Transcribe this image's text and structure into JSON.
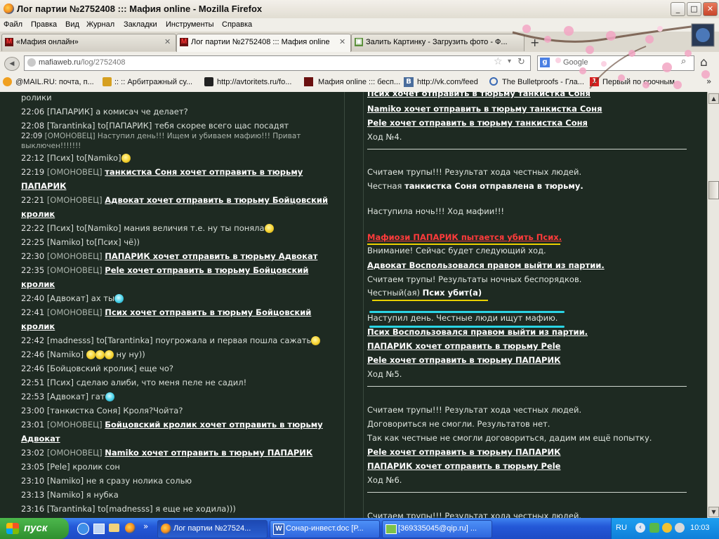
{
  "window": {
    "title": "Лог партии №2752408 ::: Мафия online - Mozilla Firefox",
    "min": "_",
    "max": "□",
    "close": "✕"
  },
  "menu": [
    "Файл",
    "Правка",
    "Вид",
    "Журнал",
    "Закладки",
    "Инструменты",
    "Справка"
  ],
  "tabs": [
    {
      "label": "«Мафия онлайн»",
      "close": "✕"
    },
    {
      "label": "Лог партии №2752408 ::: Мафия online",
      "close": "✕"
    },
    {
      "label": "Залить Картинку - Загрузить фото - Ф...",
      "close": "✕"
    }
  ],
  "tab_new": "+",
  "nav": {
    "back": "◀",
    "forward": "▶",
    "url_domain": "mafiaweb.ru",
    "url_path": "/log/2752408",
    "search_engine": "Google",
    "home": "⌂"
  },
  "bookmarks": [
    "@MAIL.RU: почта, п...",
    ":: :: Арбитражный су...",
    "http://avtoritets.ru/fo...",
    "Мафия online ::: бесп...",
    "http://vk.com/feed",
    "The Bulletproofs - Гла...",
    "Первый по срочным"
  ],
  "left_log": [
    {
      "time": "",
      "who": "",
      "msg": "ролики"
    },
    {
      "time": "22:06",
      "who": "[ПАПАРИК]",
      "msg": "а комисач че делает?"
    },
    {
      "time": "22:08",
      "who": "[Tarantinka]",
      "msg": "to[ПАПАРИК] тебя скорее всего щас посадят"
    },
    {
      "time": "22:09",
      "who": "[ОМОНОВЕЦ]",
      "msg": "Наступил день!!! Ищем и убиваем мафию!!! Приват"
    },
    {
      "time": "",
      "who": "",
      "msg": "выключен!!!!!!!"
    },
    {
      "time": "22:12",
      "who": "[Псих]",
      "msg": "to[Namiko]"
    },
    {
      "time": "22:19",
      "who": "[ОМОНОВЕЦ]",
      "msg": "танкистка Соня хочет отправить в тюрьму"
    },
    {
      "time": "",
      "who": "",
      "msg": "ПАПАРИК"
    },
    {
      "time": "22:21",
      "who": "[ОМОНОВЕЦ]",
      "msg": "Адвокат хочет отправить в тюрьму Бойцовский"
    },
    {
      "time": "",
      "who": "",
      "msg": "кролик"
    },
    {
      "time": "22:22",
      "who": "[Псих]",
      "msg": "to[Namiko] мания величия т.е. ну ты поняла"
    },
    {
      "time": "22:25",
      "who": "[Namiko]",
      "msg": "to[Псих] чё))"
    },
    {
      "time": "22:30",
      "who": "[ОМОНОВЕЦ]",
      "msg": "ПАПАРИК хочет отправить в тюрьму Адвокат"
    },
    {
      "time": "22:35",
      "who": "[ОМОНОВЕЦ]",
      "msg": "Pele хочет отправить в тюрьму Бойцовский"
    },
    {
      "time": "",
      "who": "",
      "msg": "кролик"
    },
    {
      "time": "22:40",
      "who": "[Адвокат]",
      "msg": "ах ты"
    },
    {
      "time": "22:41",
      "who": "[ОМОНОВЕЦ]",
      "msg": "Псих хочет отправить в тюрьму Бойцовский"
    },
    {
      "time": "",
      "who": "",
      "msg": "кролик"
    },
    {
      "time": "22:42",
      "who": "[madnesss]",
      "msg": "to[Tarantinka] поугрожала и первая пошла сажать"
    },
    {
      "time": "22:46",
      "who": "[Namiko]",
      "msg": "to[Псих]"
    },
    {
      "time": "",
      "who": "",
      "msg": "ну ну))"
    },
    {
      "time": "22:46",
      "who": "[Бойцовский кролик]",
      "msg": "еще чо?"
    },
    {
      "time": "22:51",
      "who": "[Псих]",
      "msg": "сделаю алиби, что меня пеле не садил!"
    },
    {
      "time": "22:53",
      "who": "[Адвокат]",
      "msg": "гат"
    },
    {
      "time": "23:00",
      "who": "[танкистка Соня]",
      "msg": "Кроля?Чойта?"
    },
    {
      "time": "23:01",
      "who": "[ОМОНОВЕЦ]",
      "msg": "Бойцовский кролик хочет отправить в тюрьму"
    },
    {
      "time": "",
      "who": "",
      "msg": "Адвокат"
    },
    {
      "time": "23:02",
      "who": "[ОМОНОВЕЦ]",
      "msg": "Namiko хочет отправить в тюрьму ПАПАРИК"
    },
    {
      "time": "23:05",
      "who": "[Pele]",
      "msg": "кролик сон"
    },
    {
      "time": "23:10",
      "who": "[Namiko]",
      "msg": "не я сразу нолика солью"
    },
    {
      "time": "23:13",
      "who": "[Namiko]",
      "msg": "я нубка"
    },
    {
      "time": "23:16",
      "who": "[Tarantinka]",
      "msg": "to[madnesss] я еще не ходила)))"
    }
  ],
  "right_log": [
    "Псих хочет отправить в тюрьму танкистка Соня",
    "Namiko хочет отправить в тюрьму танкистка Соня",
    "Pele хочет отправить в тюрьму танкистка Соня",
    "Ход №4.",
    "Считаем трупы!!! Результат хода честных людей.",
    "Честная",
    "танкистка Соня отправлена в тюрьму.",
    "Наступила ночь!!! Ход мафии!!!",
    "Мафиози ПАПАРИК пытается убить Псих.",
    "Внимание! Сейчас будет следующий ход.",
    "Адвокат Воспользовался правом выйти из партии.",
    "Считаем трупы! Результаты ночных беспорядков.",
    "Честный(ая)",
    "Псих убит(а)",
    "Наступил день. Честные люди ищут мафию.",
    "Псих Воспользовался правом выйти из партии.",
    "ПАПАРИК хочет отправить в тюрьму Pele",
    "Pele хочет отправить в тюрьму ПАПАРИК",
    "Ход №5.",
    "Считаем трупы!!! Результат хода честных людей.",
    "Договориться не смогли. Результатов нет.",
    "Так как честные не смогли договориться, дадим им ещё попытку.",
    "Pele хочет отправить в тюрьму ПАПАРИК",
    "ПАПАРИК хочет отправить в тюрьму Pele",
    "Ход №6.",
    "Считаем трупы!!! Результат хода честных людей."
  ],
  "taskbar": {
    "start": "пуск",
    "tasks": [
      "Лог партии №27524...",
      "Сонар-инвест.doc [Р...",
      "[369335045@qip.ru] ..."
    ],
    "lang": "RU",
    "clock": "10:03"
  },
  "colors": {
    "content_bg": "#1e2a22",
    "mafia_red": "#ff3b3b",
    "cyan_mark": "#2ad4e4",
    "yellow_mark": "#e8d000"
  }
}
